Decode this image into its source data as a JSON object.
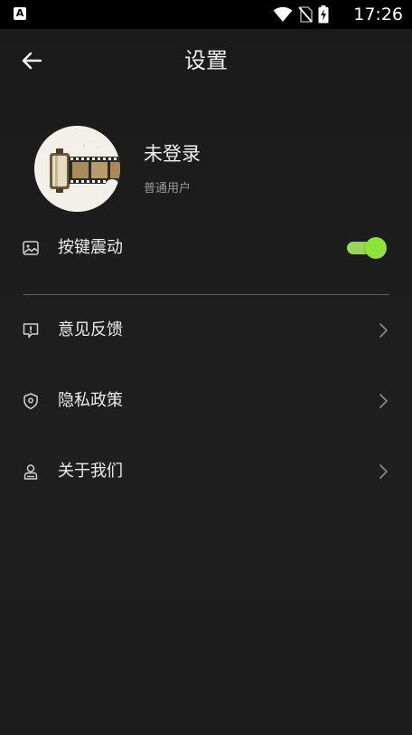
{
  "status_bar": {
    "app_indicator": "A",
    "time": "17:26",
    "icons": [
      "wifi-icon",
      "no-sim-icon",
      "battery-charging-icon"
    ]
  },
  "header": {
    "title": "设置",
    "back_icon": "arrow-left-icon"
  },
  "profile": {
    "name": "未登录",
    "role": "普通用户",
    "avatar_icon": "film-roll-icon"
  },
  "settings": {
    "vibration": {
      "label": "按键震动",
      "icon": "image-icon",
      "enabled": true
    },
    "items": [
      {
        "label": "意见反馈",
        "icon": "feedback-icon"
      },
      {
        "label": "隐私政策",
        "icon": "shield-icon"
      },
      {
        "label": "关于我们",
        "icon": "user-icon"
      }
    ]
  },
  "colors": {
    "background": "#1c1c1c",
    "toggle_on": "#8fe23a",
    "text_primary": "#ececec",
    "text_secondary": "#9a9a9a"
  }
}
